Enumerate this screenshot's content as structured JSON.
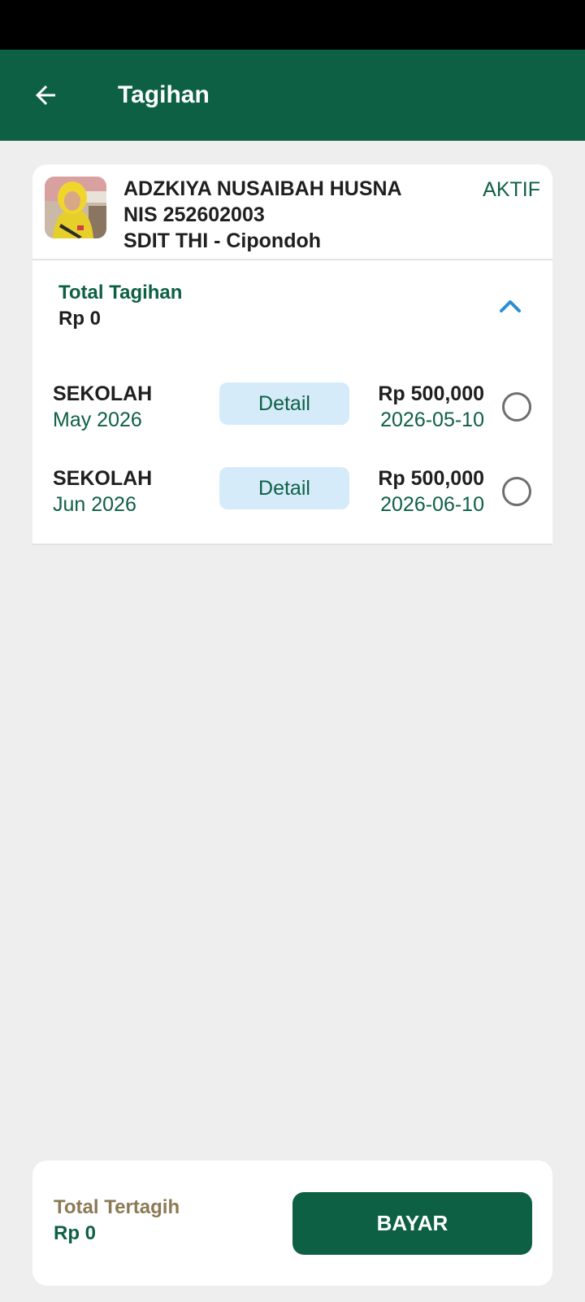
{
  "header": {
    "title": "Tagihan",
    "back_icon": "arrow-left-icon",
    "background": "#0e6045"
  },
  "student": {
    "name": "ADZKIYA NUSAIBAH HUSNA",
    "nis": "NIS 252602003",
    "school": "SDIT THI - Cipondoh",
    "status": "AKTIF"
  },
  "total_tagihan": {
    "label": "Total Tagihan",
    "value": "Rp 0",
    "toggle_icon": "chevron-up-icon"
  },
  "bills": [
    {
      "name": "SEKOLAH",
      "period": "May 2026",
      "detail_label": "Detail",
      "amount": "Rp 500,000",
      "due_date": "2026-05-10"
    },
    {
      "name": "SEKOLAH",
      "period": "Jun 2026",
      "detail_label": "Detail",
      "amount": "Rp 500,000",
      "due_date": "2026-06-10"
    }
  ],
  "footer": {
    "label": "Total Tertagih",
    "value": "Rp 0",
    "pay_label": "BAYAR"
  },
  "colors": {
    "primary": "#0e6045",
    "accent_blue": "#2a8fd4",
    "detail_bg": "#d5ebfa",
    "footer_label": "#8b7a55"
  }
}
